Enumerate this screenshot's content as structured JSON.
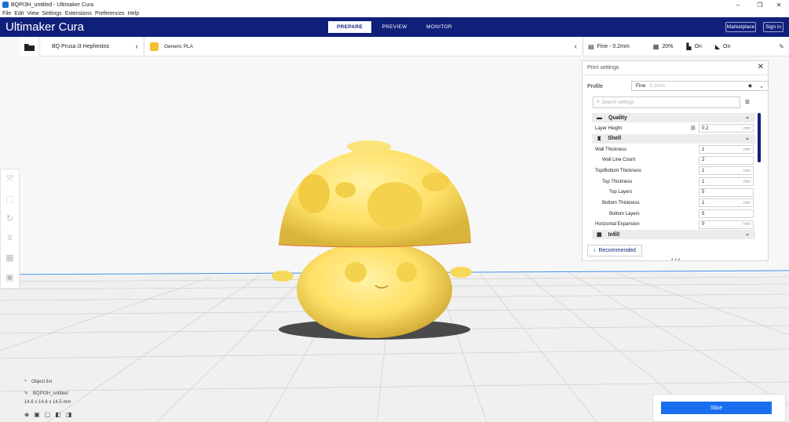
{
  "window": {
    "title": "BQPI3H_untitled - Ultimaker Cura",
    "minimize": "–",
    "maximize": "❐",
    "close": "✕"
  },
  "menu": [
    "File",
    "Edit",
    "View",
    "Settings",
    "Extensions",
    "Preferences",
    "Help"
  ],
  "brand": "Ultimaker Cura",
  "stages": [
    {
      "label": "PREPARE",
      "active": true
    },
    {
      "label": "PREVIEW",
      "active": false
    },
    {
      "label": "MONITOR",
      "active": false
    }
  ],
  "header_buttons": {
    "marketplace": "Marketplace",
    "signin": "Sign in"
  },
  "printer": {
    "name": "BQ Prusa i3 Hephestos"
  },
  "material": {
    "name": "Generic PLA",
    "color": "#f2c12e"
  },
  "print_summary": {
    "profile": "Fine - 0.2mm",
    "infill": "20%",
    "support": "On",
    "adhesion": "On"
  },
  "print_settings": {
    "title": "Print settings",
    "profile_label": "Profile",
    "profile_value": "Fine",
    "profile_hint": "0.2mm",
    "search_placeholder": "Search settings",
    "categories": {
      "quality": "Quality",
      "shell": "Shell",
      "infill": "Infill"
    },
    "settings": [
      {
        "label": "Layer Height",
        "value": "0.2",
        "unit": "mm",
        "indent": 0,
        "linked": true
      },
      {
        "label": "Wall Thickness",
        "value": "1",
        "unit": "mm",
        "indent": 0
      },
      {
        "label": "Wall Line Count",
        "value": "2",
        "unit": "",
        "indent": 1
      },
      {
        "label": "Top/Bottom Thickness",
        "value": "1",
        "unit": "mm",
        "indent": 0
      },
      {
        "label": "Top Thickness",
        "value": "1",
        "unit": "mm",
        "indent": 1
      },
      {
        "label": "Top Layers",
        "value": "5",
        "unit": "",
        "indent": 2
      },
      {
        "label": "Bottom Thickness",
        "value": "1",
        "unit": "mm",
        "indent": 1
      },
      {
        "label": "Bottom Layers",
        "value": "5",
        "unit": "",
        "indent": 2
      },
      {
        "label": "Horizontal Expansion",
        "value": "0",
        "unit": "mm",
        "indent": 0
      }
    ],
    "recommended_button": "Recommended"
  },
  "object_list": {
    "label": "Object list",
    "object_name": "BQPI3H_untitled",
    "dimensions": "14.6 x 14.6 x 14.5 mm"
  },
  "slice_button": "Slice",
  "colors": {
    "header": "#10207a",
    "accent": "#196ef0",
    "model": "#ffe066"
  }
}
